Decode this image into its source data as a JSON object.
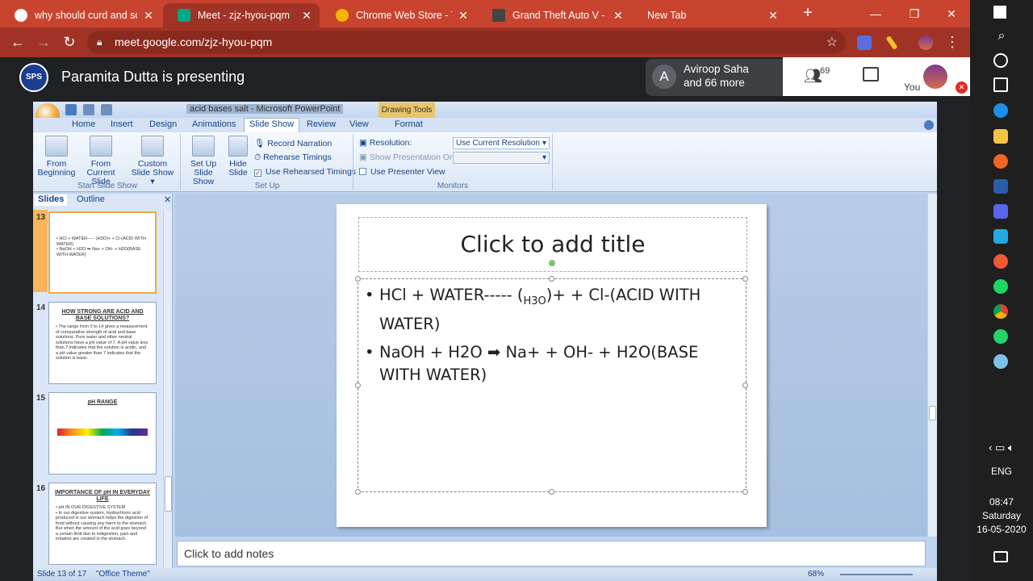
{
  "browser": {
    "tabs": [
      {
        "title": "why should curd and sou",
        "favicon_color": "#4285f4",
        "active": false
      },
      {
        "title": "Meet - zjz-hyou-pqm",
        "favicon_color": "#00897b",
        "active": true
      },
      {
        "title": "Chrome Web Store - The",
        "favicon_color": "#db4437",
        "active": false
      },
      {
        "title": "Grand Theft Auto V - Gr",
        "favicon_color": "#333333",
        "active": false
      },
      {
        "title": "New Tab",
        "favicon_color": "",
        "active": false
      }
    ],
    "url": "meet.google.com/zjz-hyou-pqm"
  },
  "meet": {
    "presenting_text": "Paramita Dutta is presenting",
    "participant_initial": "A",
    "participant_name": "Aviroop Saha",
    "participant_more": "and 66 more",
    "people_count": "69",
    "you_label": "You",
    "logo_text": "SPS"
  },
  "powerpoint": {
    "window_title": "acid bases salt - Microsoft PowerPoint",
    "contextual_tab": "Drawing Tools",
    "menu": [
      "Home",
      "Insert",
      "Design",
      "Animations",
      "Slide Show",
      "Review",
      "View",
      "Format"
    ],
    "active_menu": "Slide Show",
    "ribbon": {
      "from_beginning": "From\nBeginning",
      "from_current": "From\nCurrent Slide",
      "custom_show": "Custom\nSlide Show ▾",
      "group_start": "Start Slide Show",
      "setup_show": "Set Up\nSlide Show",
      "hide_slide": "Hide\nSlide",
      "record_narration": "Record Narration",
      "rehearse_timings": "Rehearse Timings",
      "use_rehearsed": "Use Rehearsed Timings",
      "group_setup": "Set Up",
      "resolution_label": "Resolution:",
      "resolution_value": "Use Current Resolution",
      "show_on_label": "Show Presentation On:",
      "presenter_view": "Use Presenter View",
      "group_monitors": "Monitors"
    },
    "panel_tabs": {
      "slides": "Slides",
      "outline": "Outline"
    },
    "thumbnails": [
      {
        "num": "13",
        "title": "",
        "body": "• HCl + WATER----- (H3O)+ + Cl-(ACID WITH WATER)\n• NaOH + H2O ➡ Na+ + OH- + H2O(BASE WITH WATER)"
      },
      {
        "num": "14",
        "title": "HOW STRONG ARE ACID AND BASE SOLUTIONS?",
        "body": "• The range from 0 to 14 gives a measurement of comparative strength of acid and base solutions. Pure water and other neutral solutions have a pH value of 7. A pH value less than 7 indicates that the solution is acidic, and a pH value greater than 7 indicates that the solution is basic."
      },
      {
        "num": "15",
        "title": "pH RANGE",
        "body": ""
      },
      {
        "num": "16",
        "title": "IMPORTANCE OF pH IN EVERYDAY LIFE",
        "body": "• pH IN OUR DIGESTIVE SYSTEM\n• In our digestive system, Hydrochloric acid produced in our stomach helps the digestion of food without causing any harm to the stomach. But when the amount of the acid goes beyond a certain limit due to indigestion, pain and irritation are created in the stomach."
      }
    ],
    "slide": {
      "title_placeholder": "Click to add title",
      "bullet1_a": "HCl +  WATER----- (",
      "bullet1_sub": "H3O",
      "bullet1_b": ")+ + Cl-(ACID WITH WATER)",
      "bullet2": "NaOH + H2O ➡ Na+ + OH- + H2O(BASE WITH WATER)"
    },
    "notes_placeholder": "Click to add notes",
    "status": {
      "slide_info": "Slide 13 of 17",
      "theme": "\"Office Theme\"",
      "zoom": "68%"
    }
  },
  "taskbar": {
    "lang": "ENG",
    "time": "08:47",
    "day": "Saturday",
    "date": "16-05-2020"
  }
}
